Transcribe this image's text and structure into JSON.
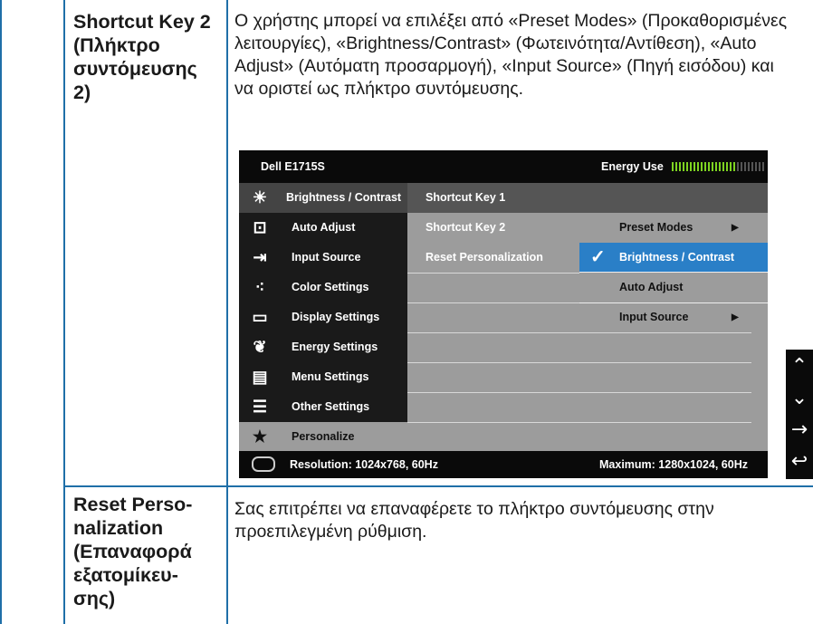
{
  "rows": [
    {
      "parameter": "Shortcut Key 2 (Πλήκτρο συντόμευσης 2)",
      "description": "Ο χρήστης μπορεί να επιλέξει από «Preset Modes» (Προκαθορισμένες λειτουργίες), «Brightness/Contrast» (Φωτεινότητα/Αντίθεση), «Auto Adjust» (Αυτόματη προσαρμογή), «Input Source» (Πηγή εισόδου) και να οριστεί ως πλήκτρο συντόμευσης."
    },
    {
      "parameter": "Reset Perso-nalization (Επαναφορά εξατομίκευ-σης)",
      "description": "Σας επιτρέπει να επαναφέρετε το πλήκτρο συντόμευσης στην προεπιλεγμένη ρύθμιση."
    }
  ],
  "osd": {
    "model": "Dell E1715S",
    "energy_label": "Energy Use",
    "menu": [
      {
        "label": "Brightness / Contrast",
        "icon": "brightness-icon"
      },
      {
        "label": "Auto Adjust",
        "icon": "auto-adjust-icon"
      },
      {
        "label": "Input Source",
        "icon": "input-source-icon"
      },
      {
        "label": "Color Settings",
        "icon": "color-settings-icon"
      },
      {
        "label": "Display Settings",
        "icon": "display-settings-icon"
      },
      {
        "label": "Energy Settings",
        "icon": "energy-settings-icon"
      },
      {
        "label": "Menu Settings",
        "icon": "menu-settings-icon"
      },
      {
        "label": "Other Settings",
        "icon": "other-settings-icon"
      },
      {
        "label": "Personalize",
        "icon": "star-icon"
      }
    ],
    "submenu": [
      "Shortcut Key 1",
      "Shortcut Key 2",
      "Reset Personalization"
    ],
    "options": [
      "Preset Modes",
      "Brightness / Contrast",
      "Auto Adjust",
      "Input Source"
    ],
    "selected_option": "Brightness / Contrast",
    "resolution": "Resolution: 1024x768, 60Hz",
    "maximum": "Maximum: 1280x1024, 60Hz",
    "accent_color": "#2a7fc7"
  },
  "nav_buttons": [
    "up-icon",
    "down-icon",
    "right-arrow-icon",
    "back-icon"
  ]
}
